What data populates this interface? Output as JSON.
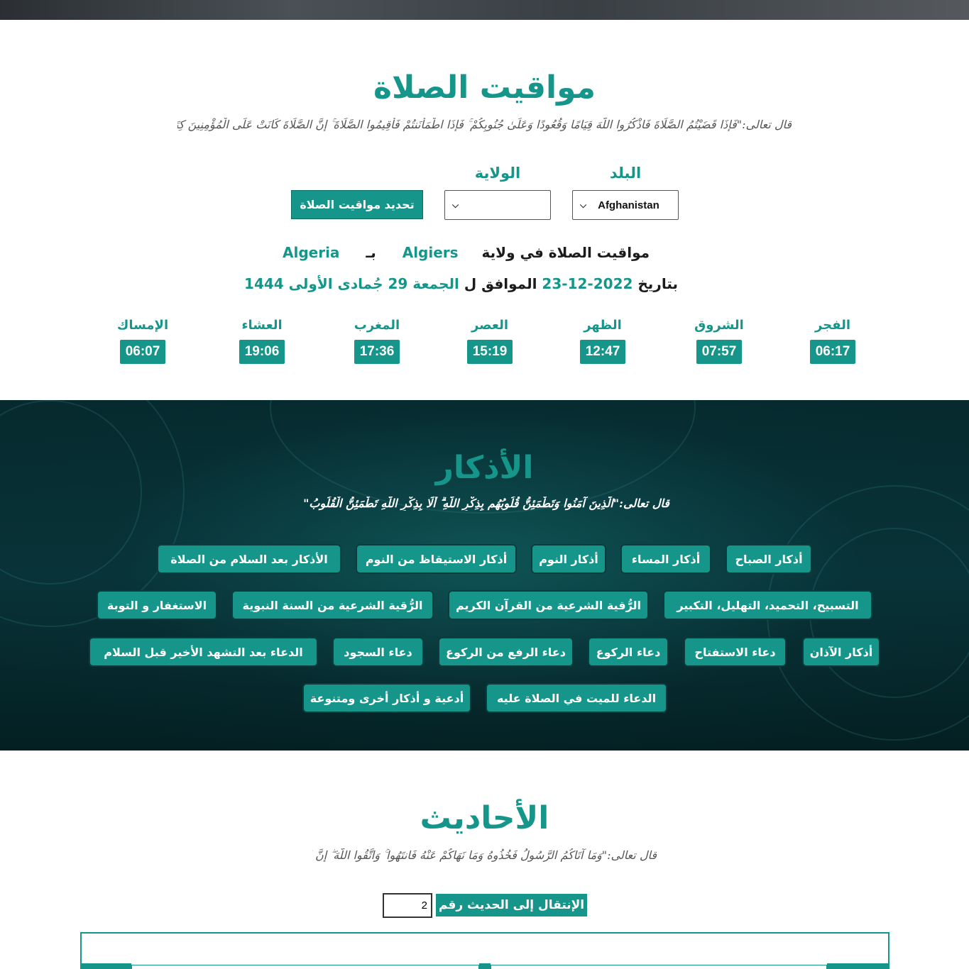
{
  "prayer": {
    "title": "مواقيت الصلاة",
    "verse": "قال تعالى:\"فَإِذَا قَضَيْتُمُ الصَّلَاةَ فَاذْكُرُوا اللَّهَ قِيَامًا وَقُعُودًا وَعَلَىٰ جُنُوبِكُمْ ۚ فَإِذَا اطْمَأْنَنتُمْ فَأَقِيمُوا الصَّلَاةَ ۚ إِنَّ الصَّلَاةَ كَانَتْ عَلَى الْمُؤْمِنِينَ كِتَابًا مَّوْقُوتًا \"",
    "country_label": "البلد",
    "state_label": "الولاية",
    "country_value": "Afghanistan",
    "state_value": "",
    "update_button": "تحديد مواقيت الصلاة",
    "line1_prefix": "مواقيت الصلاة في ولاية",
    "line1_city": "Algiers",
    "line1_sep": "بـ",
    "line1_country": "Algeria",
    "line2_prefix": "بتاريخ",
    "line2_date": "2022-12-23",
    "line2_mid": "الموافق ل",
    "line2_hijri": "الجمعة 29 جُمادى الأولى 1444",
    "times": [
      {
        "name": "الفجر",
        "time": "06:17"
      },
      {
        "name": "الشروق",
        "time": "07:57"
      },
      {
        "name": "الظهر",
        "time": "12:47"
      },
      {
        "name": "العصر",
        "time": "15:19"
      },
      {
        "name": "المغرب",
        "time": "17:36"
      },
      {
        "name": "العشاء",
        "time": "19:06"
      },
      {
        "name": "الإمساك",
        "time": "06:07"
      }
    ]
  },
  "adhkar": {
    "title": "الأذكار",
    "verse": "قال تعالى:\"الَّذِينَ آمَنُوا وَتَطْمَئِنُّ قُلُوبُهُم بِذِكْرِ اللَّهِ ۗ أَلَا بِذِكْرِ اللَّهِ تَطْمَئِنُّ الْقُلُوبُ\"",
    "buttons": [
      "أذكار الصباح",
      "أذكار المساء",
      "أذكار النوم",
      "أذكار الاستيقاظ من النوم",
      "الأذكار بعد السلام من الصلاة",
      "التسبيح، التحميد، التهليل، التكبير",
      "الرُّقية الشرعية من القرآن الكريم",
      "الرُّقية الشرعية من السنة النبوية",
      "الاستغفار و التوبة",
      "أذكار الآذان",
      "دعاء الاستفتاح",
      "دعاء الركوع",
      "دعاء الرفع من الركوع",
      "دعاء السجود",
      "الدعاء بعد التشهد الأخير قبل السلام",
      "الدعاء للميت في الصلاة عليه",
      "أدعية و أذكار أخرى ومتنوعة"
    ]
  },
  "hadith": {
    "title": "الأحاديث",
    "verse": "قال تعالى:\"وَمَا آتَاكُمُ الرَّسُولُ فَخُذُوهُ وَمَا نَهَاكُمْ عَنْهُ فَانتَهُوا ۚ وَاتَّقُوا اللَّهَ ۖ إِنَّ اللَّهَ شَدِيدُ الْعِقَابِ\"",
    "goto_label": "الإنتقال إلى الحديث رقم",
    "goto_value": "2"
  },
  "colors": {
    "accent": "#16968a",
    "dark_bg": "#083338"
  }
}
